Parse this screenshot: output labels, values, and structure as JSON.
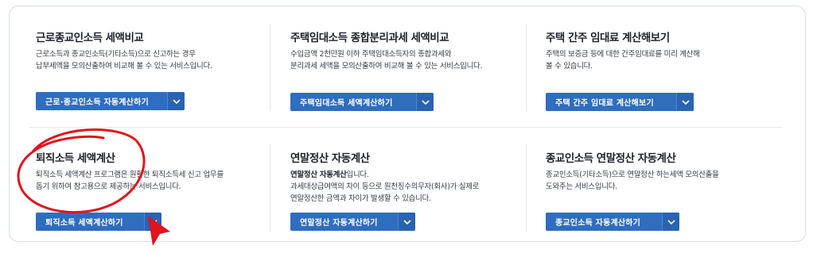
{
  "cards": [
    {
      "title": "근로종교인소득 세액비교",
      "desc": [
        "근로소득과 종교인소득(기타소득)으로 신고하는 경우",
        "납부세액을 모의산출하여 비교해 볼 수 있는 서비스입니다."
      ],
      "button": "근로·종교인소득 자동계산하기"
    },
    {
      "title": "주택임대소득 종합분리과세 세액비교",
      "desc": [
        "수입금액 2천만원 이하 주택임대소득자의 종합과세와",
        "분리과세 세액을 모의산출하여 비교해 볼 수 있는 서비스입니다."
      ],
      "button": "주택임대소득 세액계산하기"
    },
    {
      "title": "주택 간주 임대료 계산해보기",
      "desc": [
        "주택의 보증금 등에 대한 간주임대료를 미리 계산해",
        "볼 수 있습니다."
      ],
      "button": "주택 간주 임대료 계산해보기"
    },
    {
      "title": "퇴직소득 세액계산",
      "desc": [
        "퇴직소득 세액계산 프로그램은 원활한 퇴직소득세 신고 업무를",
        "돕기 위하여 참고용으로 제공하는 서비스입니다."
      ],
      "button": "퇴직소득 세액계산하기"
    },
    {
      "title": "연말정산 자동계산",
      "desc_strong": "연말정산 자동계산",
      "desc_rest": "입니다.",
      "desc": [
        "과세대상급여액의 차이 등으로 원천징수의무자(회사)가 실제로",
        "연말정산한 금액과 차이가 발생할 수 있습니다."
      ],
      "button": "연말정산 자동계산하기"
    },
    {
      "title": "종교인소득 연말정산 자동계산",
      "desc": [
        "종교인소득(기타소득)으로 연말정산 하는세액 모의산출을",
        "도와주는 서비스입니다."
      ],
      "button": "종교인소득 자동계산하기"
    }
  ],
  "icons": {
    "dropdown": "chevron-down-icon"
  },
  "colors": {
    "button_blue": "#2f6dbf",
    "annotation_red": "#e0141e"
  }
}
